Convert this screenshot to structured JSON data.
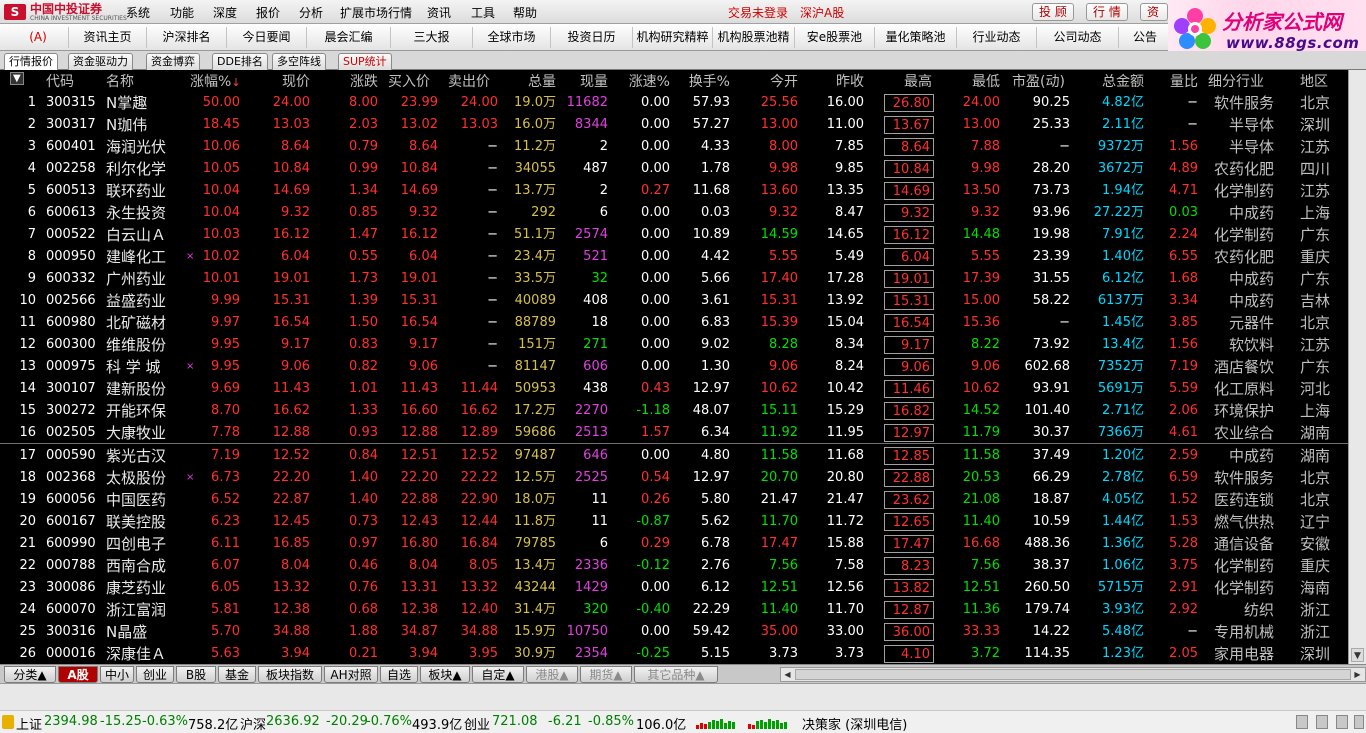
{
  "titlebar": {
    "logo_cn": "中国中投证券",
    "logo_en": "CHINA INVESTMENT SECURITIES",
    "menu": [
      "系统",
      "功能",
      "深度",
      "报价",
      "分析",
      "扩展市场行情",
      "资讯",
      "工具",
      "帮助"
    ],
    "login_status": "交易未登录",
    "market_link": "深沪A股",
    "buttons": [
      "投 顾",
      "行 情",
      "资"
    ]
  },
  "brand": {
    "line1": "分析家公式网",
    "line2": "www.88gs.com"
  },
  "nav": {
    "home": "(A)",
    "items": [
      "资讯主页",
      "沪深排名",
      "今日要闻",
      "晨会汇编",
      "三大报",
      "全球市场",
      "投资日历",
      "机构研究精粹",
      "机构股票池精",
      "安e股票池",
      "量化策略池",
      "行业动态",
      "公司动态",
      "公告全"
    ]
  },
  "subtabs": [
    "行情报价",
    "资金驱动力",
    "资金博弈",
    "DDE排名",
    "多空阵线",
    "SUP统计"
  ],
  "table": {
    "menu_glyph": "▼",
    "headers": [
      "代码",
      "名称",
      "涨幅%",
      "现价",
      "涨跌",
      "买入价",
      "卖出价",
      "总量",
      "现量",
      "涨速%",
      "换手%",
      "今开",
      "昨收",
      "最高",
      "最低",
      "市盈(动)",
      "总金额",
      "量比",
      "细分行业",
      "地区"
    ],
    "sort_arrow": "↓",
    "rows": [
      {
        "no": "1",
        "code": "300315",
        "name": "N掌趣",
        "mark": "",
        "chg_pct": "50.00",
        "price": "24.00",
        "chg": "8.00",
        "bid": "23.99",
        "ask": "24.00",
        "vol": "19.0",
        "vol_unit": "万",
        "cur": "11682",
        "speed": "0.00",
        "turn": "57.93",
        "open": "25.56",
        "prev": "16.00",
        "high": "26.80",
        "low": "24.00",
        "pe": "90.25",
        "amt": "4.82",
        "amt_unit": "亿",
        "vr": "−",
        "ind": "软件服务",
        "region": "北京"
      },
      {
        "no": "2",
        "code": "300317",
        "name": "N珈伟",
        "mark": "",
        "chg_pct": "18.45",
        "price": "13.03",
        "chg": "2.03",
        "bid": "13.02",
        "ask": "13.03",
        "vol": "16.0",
        "vol_unit": "万",
        "cur": "8344",
        "speed": "0.00",
        "turn": "57.27",
        "open": "13.00",
        "prev": "11.00",
        "high": "13.67",
        "low": "13.00",
        "pe": "25.33",
        "amt": "2.11",
        "amt_unit": "亿",
        "vr": "−",
        "ind": "半导体",
        "region": "深圳"
      },
      {
        "no": "3",
        "code": "600401",
        "name": "海润光伏",
        "mark": "",
        "chg_pct": "10.06",
        "price": "8.64",
        "chg": "0.79",
        "bid": "8.64",
        "ask": "−",
        "vol": "11.2",
        "vol_unit": "万",
        "cur": "2",
        "speed": "0.00",
        "turn": "4.33",
        "open": "8.00",
        "prev": "7.85",
        "high": "8.64",
        "low": "7.88",
        "pe": "−",
        "amt": "9372",
        "amt_unit": "万",
        "vr": "1.56",
        "ind": "半导体",
        "region": "江苏"
      },
      {
        "no": "4",
        "code": "002258",
        "name": "利尔化学",
        "mark": "",
        "chg_pct": "10.05",
        "price": "10.84",
        "chg": "0.99",
        "bid": "10.84",
        "ask": "−",
        "vol": "34055",
        "vol_unit": "",
        "cur": "487",
        "speed": "0.00",
        "turn": "1.78",
        "open": "9.98",
        "prev": "9.85",
        "high": "10.84",
        "low": "9.98",
        "pe": "28.20",
        "amt": "3672",
        "amt_unit": "万",
        "vr": "4.89",
        "ind": "农药化肥",
        "region": "四川"
      },
      {
        "no": "5",
        "code": "600513",
        "name": "联环药业",
        "mark": "",
        "chg_pct": "10.04",
        "price": "14.69",
        "chg": "1.34",
        "bid": "14.69",
        "ask": "−",
        "vol": "13.7",
        "vol_unit": "万",
        "cur": "2",
        "speed": "0.27",
        "turn": "11.68",
        "open": "13.60",
        "prev": "13.35",
        "high": "14.69",
        "low": "13.50",
        "pe": "73.73",
        "amt": "1.94",
        "amt_unit": "亿",
        "vr": "4.71",
        "ind": "化学制药",
        "region": "江苏"
      },
      {
        "no": "6",
        "code": "600613",
        "name": "永生投资",
        "mark": "",
        "chg_pct": "10.04",
        "price": "9.32",
        "chg": "0.85",
        "bid": "9.32",
        "ask": "−",
        "vol": "292",
        "vol_unit": "",
        "cur": "6",
        "speed": "0.00",
        "turn": "0.03",
        "open": "9.32",
        "prev": "8.47",
        "high": "9.32",
        "low": "9.32",
        "pe": "93.96",
        "amt": "27.22",
        "amt_unit": "万",
        "vr": "0.03",
        "ind": "中成药",
        "region": "上海"
      },
      {
        "no": "7",
        "code": "000522",
        "name": "白云山Ａ",
        "mark": "",
        "chg_pct": "10.03",
        "price": "16.12",
        "chg": "1.47",
        "bid": "16.12",
        "ask": "−",
        "vol": "51.1",
        "vol_unit": "万",
        "cur": "2574",
        "speed": "0.00",
        "turn": "10.89",
        "open": "14.59",
        "prev": "14.65",
        "high": "16.12",
        "low": "14.48",
        "pe": "19.98",
        "amt": "7.91",
        "amt_unit": "亿",
        "vr": "2.24",
        "ind": "化学制药",
        "region": "广东"
      },
      {
        "no": "8",
        "code": "000950",
        "name": "建峰化工",
        "mark": "×",
        "chg_pct": "10.02",
        "price": "6.04",
        "chg": "0.55",
        "bid": "6.04",
        "ask": "−",
        "vol": "23.4",
        "vol_unit": "万",
        "cur": "521",
        "speed": "0.00",
        "turn": "4.42",
        "open": "5.55",
        "prev": "5.49",
        "high": "6.04",
        "low": "5.55",
        "pe": "23.39",
        "amt": "1.40",
        "amt_unit": "亿",
        "vr": "6.55",
        "ind": "农药化肥",
        "region": "重庆"
      },
      {
        "no": "9",
        "code": "600332",
        "name": "广州药业",
        "mark": "",
        "chg_pct": "10.01",
        "price": "19.01",
        "chg": "1.73",
        "bid": "19.01",
        "ask": "−",
        "vol": "33.5",
        "vol_unit": "万",
        "cur": "32",
        "speed": "0.00",
        "turn": "5.66",
        "open": "17.40",
        "prev": "17.28",
        "high": "19.01",
        "low": "17.39",
        "pe": "31.55",
        "amt": "6.12",
        "amt_unit": "亿",
        "vr": "1.68",
        "ind": "中成药",
        "region": "广东"
      },
      {
        "no": "10",
        "code": "002566",
        "name": "益盛药业",
        "mark": "",
        "chg_pct": "9.99",
        "price": "15.31",
        "chg": "1.39",
        "bid": "15.31",
        "ask": "−",
        "vol": "40089",
        "vol_unit": "",
        "cur": "408",
        "speed": "0.00",
        "turn": "3.61",
        "open": "15.31",
        "prev": "13.92",
        "high": "15.31",
        "low": "15.00",
        "pe": "58.22",
        "amt": "6137",
        "amt_unit": "万",
        "vr": "3.34",
        "ind": "中成药",
        "region": "吉林"
      },
      {
        "no": "11",
        "code": "600980",
        "name": "北矿磁材",
        "mark": "",
        "chg_pct": "9.97",
        "price": "16.54",
        "chg": "1.50",
        "bid": "16.54",
        "ask": "−",
        "vol": "88789",
        "vol_unit": "",
        "cur": "18",
        "speed": "0.00",
        "turn": "6.83",
        "open": "15.39",
        "prev": "15.04",
        "high": "16.54",
        "low": "15.36",
        "pe": "−",
        "amt": "1.45",
        "amt_unit": "亿",
        "vr": "3.85",
        "ind": "元器件",
        "region": "北京"
      },
      {
        "no": "12",
        "code": "600300",
        "name": "维维股份",
        "mark": "",
        "chg_pct": "9.95",
        "price": "9.17",
        "chg": "0.83",
        "bid": "9.17",
        "ask": "−",
        "vol": "151",
        "vol_unit": "万",
        "cur": "271",
        "speed": "0.00",
        "turn": "9.02",
        "open": "8.28",
        "prev": "8.34",
        "high": "9.17",
        "low": "8.22",
        "pe": "73.92",
        "amt": "13.4",
        "amt_unit": "亿",
        "vr": "1.56",
        "ind": "软饮料",
        "region": "江苏"
      },
      {
        "no": "13",
        "code": "000975",
        "name": "科 学 城",
        "mark": "×",
        "chg_pct": "9.95",
        "price": "9.06",
        "chg": "0.82",
        "bid": "9.06",
        "ask": "−",
        "vol": "81147",
        "vol_unit": "",
        "cur": "606",
        "speed": "0.00",
        "turn": "1.30",
        "open": "9.06",
        "prev": "8.24",
        "high": "9.06",
        "low": "9.06",
        "pe": "602.68",
        "amt": "7352",
        "amt_unit": "万",
        "vr": "7.19",
        "ind": "酒店餐饮",
        "region": "广东"
      },
      {
        "no": "14",
        "code": "300107",
        "name": "建新股份",
        "mark": "",
        "chg_pct": "9.69",
        "price": "11.43",
        "chg": "1.01",
        "bid": "11.43",
        "ask": "11.44",
        "vol": "50953",
        "vol_unit": "",
        "cur": "438",
        "speed": "0.43",
        "turn": "12.97",
        "open": "10.62",
        "prev": "10.42",
        "high": "11.46",
        "low": "10.62",
        "pe": "93.91",
        "amt": "5691",
        "amt_unit": "万",
        "vr": "5.59",
        "ind": "化工原料",
        "region": "河北"
      },
      {
        "no": "15",
        "code": "300272",
        "name": "开能环保",
        "mark": "",
        "chg_pct": "8.70",
        "price": "16.62",
        "chg": "1.33",
        "bid": "16.60",
        "ask": "16.62",
        "vol": "17.2",
        "vol_unit": "万",
        "cur": "2270",
        "speed": "-1.18",
        "turn": "48.07",
        "open": "15.11",
        "prev": "15.29",
        "high": "16.82",
        "low": "14.52",
        "pe": "101.40",
        "amt": "2.71",
        "amt_unit": "亿",
        "vr": "2.06",
        "ind": "环境保护",
        "region": "上海"
      },
      {
        "no": "16",
        "code": "002505",
        "name": "大康牧业",
        "mark": "",
        "chg_pct": "7.78",
        "price": "12.88",
        "chg": "0.93",
        "bid": "12.88",
        "ask": "12.89",
        "vol": "59686",
        "vol_unit": "",
        "cur": "2513",
        "speed": "1.57",
        "turn": "6.34",
        "open": "11.92",
        "prev": "11.95",
        "high": "12.97",
        "low": "11.79",
        "pe": "30.37",
        "amt": "7366",
        "amt_unit": "万",
        "vr": "4.61",
        "ind": "农业综合",
        "region": "湖南"
      },
      {
        "no": "17",
        "code": "000590",
        "name": "紫光古汉",
        "mark": "",
        "chg_pct": "7.19",
        "price": "12.52",
        "chg": "0.84",
        "bid": "12.51",
        "ask": "12.52",
        "vol": "97487",
        "vol_unit": "",
        "cur": "646",
        "speed": "0.00",
        "turn": "4.80",
        "open": "11.58",
        "prev": "11.68",
        "high": "12.85",
        "low": "11.58",
        "pe": "37.49",
        "amt": "1.20",
        "amt_unit": "亿",
        "vr": "2.59",
        "ind": "中成药",
        "region": "湖南"
      },
      {
        "no": "18",
        "code": "002368",
        "name": "太极股份",
        "mark": "×",
        "chg_pct": "6.73",
        "price": "22.20",
        "chg": "1.40",
        "bid": "22.20",
        "ask": "22.22",
        "vol": "12.5",
        "vol_unit": "万",
        "cur": "2525",
        "speed": "0.54",
        "turn": "12.97",
        "open": "20.70",
        "prev": "20.80",
        "high": "22.88",
        "low": "20.53",
        "pe": "66.29",
        "amt": "2.78",
        "amt_unit": "亿",
        "vr": "6.59",
        "ind": "软件服务",
        "region": "北京"
      },
      {
        "no": "19",
        "code": "600056",
        "name": "中国医药",
        "mark": "",
        "chg_pct": "6.52",
        "price": "22.87",
        "chg": "1.40",
        "bid": "22.88",
        "ask": "22.90",
        "vol": "18.0",
        "vol_unit": "万",
        "cur": "11",
        "speed": "0.26",
        "turn": "5.80",
        "open": "21.47",
        "prev": "21.47",
        "high": "23.62",
        "low": "21.08",
        "pe": "18.87",
        "amt": "4.05",
        "amt_unit": "亿",
        "vr": "1.52",
        "ind": "医药连锁",
        "region": "北京"
      },
      {
        "no": "20",
        "code": "600167",
        "name": "联美控股",
        "mark": "",
        "chg_pct": "6.23",
        "price": "12.45",
        "chg": "0.73",
        "bid": "12.43",
        "ask": "12.44",
        "vol": "11.8",
        "vol_unit": "万",
        "cur": "11",
        "speed": "-0.87",
        "turn": "5.62",
        "open": "11.70",
        "prev": "11.72",
        "high": "12.65",
        "low": "11.40",
        "pe": "10.59",
        "amt": "1.44",
        "amt_unit": "亿",
        "vr": "1.53",
        "ind": "燃气供热",
        "region": "辽宁"
      },
      {
        "no": "21",
        "code": "600990",
        "name": "四创电子",
        "mark": "",
        "chg_pct": "6.11",
        "price": "16.85",
        "chg": "0.97",
        "bid": "16.80",
        "ask": "16.84",
        "vol": "79785",
        "vol_unit": "",
        "cur": "6",
        "speed": "0.29",
        "turn": "6.78",
        "open": "17.47",
        "prev": "15.88",
        "high": "17.47",
        "low": "16.68",
        "pe": "488.36",
        "amt": "1.36",
        "amt_unit": "亿",
        "vr": "5.28",
        "ind": "通信设备",
        "region": "安徽"
      },
      {
        "no": "22",
        "code": "000788",
        "name": "西南合成",
        "mark": "",
        "chg_pct": "6.07",
        "price": "8.04",
        "chg": "0.46",
        "bid": "8.04",
        "ask": "8.05",
        "vol": "13.4",
        "vol_unit": "万",
        "cur": "2336",
        "speed": "-0.12",
        "turn": "2.76",
        "open": "7.56",
        "prev": "7.58",
        "high": "8.23",
        "low": "7.56",
        "pe": "38.37",
        "amt": "1.06",
        "amt_unit": "亿",
        "vr": "3.75",
        "ind": "化学制药",
        "region": "重庆"
      },
      {
        "no": "23",
        "code": "300086",
        "name": "康芝药业",
        "mark": "",
        "chg_pct": "6.05",
        "price": "13.32",
        "chg": "0.76",
        "bid": "13.31",
        "ask": "13.32",
        "vol": "43244",
        "vol_unit": "",
        "cur": "1429",
        "speed": "0.00",
        "turn": "6.12",
        "open": "12.51",
        "prev": "12.56",
        "high": "13.82",
        "low": "12.51",
        "pe": "260.50",
        "amt": "5715",
        "amt_unit": "万",
        "vr": "2.91",
        "ind": "化学制药",
        "region": "海南"
      },
      {
        "no": "24",
        "code": "600070",
        "name": "浙江富润",
        "mark": "",
        "chg_pct": "5.81",
        "price": "12.38",
        "chg": "0.68",
        "bid": "12.38",
        "ask": "12.40",
        "vol": "31.4",
        "vol_unit": "万",
        "cur": "320",
        "speed": "-0.40",
        "turn": "22.29",
        "open": "11.40",
        "prev": "11.70",
        "high": "12.87",
        "low": "11.36",
        "pe": "179.74",
        "amt": "3.93",
        "amt_unit": "亿",
        "vr": "2.92",
        "ind": "纺织",
        "region": "浙江"
      },
      {
        "no": "25",
        "code": "300316",
        "name": "N晶盛",
        "mark": "",
        "chg_pct": "5.70",
        "price": "34.88",
        "chg": "1.88",
        "bid": "34.87",
        "ask": "34.88",
        "vol": "15.9",
        "vol_unit": "万",
        "cur": "10750",
        "speed": "0.00",
        "turn": "59.42",
        "open": "35.00",
        "prev": "33.00",
        "high": "36.00",
        "low": "33.33",
        "pe": "14.22",
        "amt": "5.48",
        "amt_unit": "亿",
        "vr": "−",
        "ind": "专用机械",
        "region": "浙江"
      },
      {
        "no": "26",
        "code": "000016",
        "name": "深康佳Ａ",
        "mark": "",
        "chg_pct": "5.63",
        "price": "3.94",
        "chg": "0.21",
        "bid": "3.94",
        "ask": "3.95",
        "vol": "30.9",
        "vol_unit": "万",
        "cur": "2354",
        "speed": "-0.25",
        "turn": "5.15",
        "open": "3.73",
        "prev": "3.73",
        "high": "4.10",
        "low": "3.72",
        "pe": "114.35",
        "amt": "1.23",
        "amt_unit": "亿",
        "vr": "2.05",
        "ind": "家用电器",
        "region": "深圳"
      }
    ]
  },
  "bottom_tabs": [
    "分类▲",
    "A股",
    "中小",
    "创业",
    "B股",
    "基金",
    "板块指数",
    "AH对照",
    "自选",
    "板块▲",
    "自定▲",
    "港股▲",
    "期货▲",
    "其它品种▲"
  ],
  "status": {
    "sh": {
      "label": "上证",
      "value": "2394.98",
      "chg": "-15.25",
      "pct": "-0.63%",
      "amt": "758.2亿"
    },
    "sz": {
      "label": "沪深",
      "value": "2636.92",
      "chg": "-20.29",
      "pct": "-0.76%",
      "amt": "493.9亿"
    },
    "cy": {
      "label": "创业",
      "value": "721.08",
      "chg": "-6.21",
      "pct": "-0.85%",
      "amt": "106.0亿"
    },
    "server": "决策家 (深圳电信)"
  },
  "colors": {
    "up": "#ff3030",
    "down": "#00e000",
    "flat": "#ffffff",
    "volume": "#e0e000",
    "amount": "#00d8ff",
    "current_vol": "#e040e0",
    "active_tab": "#b00000"
  }
}
